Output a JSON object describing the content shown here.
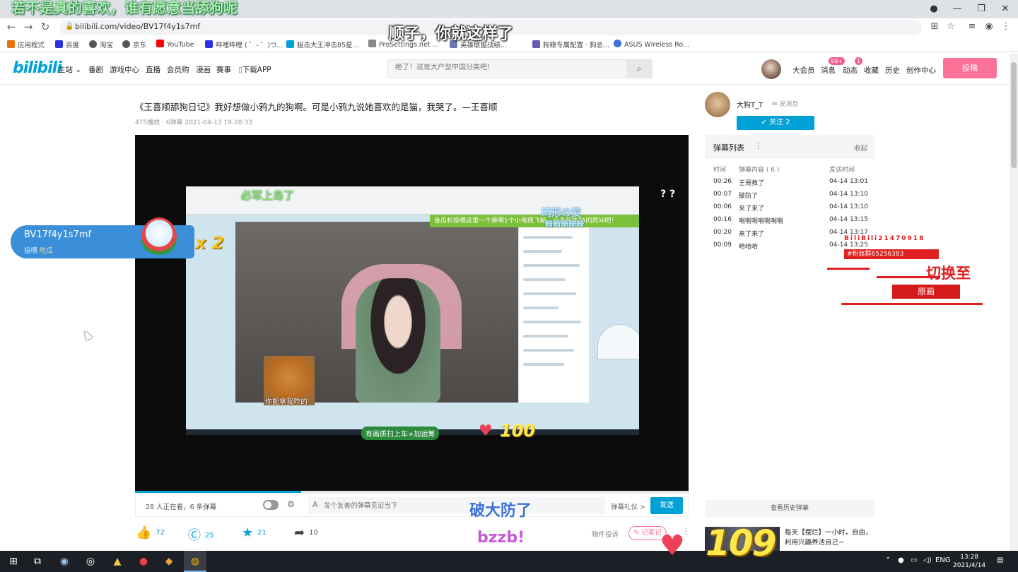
{
  "browser": {
    "url": "bilibili.com/video/BV17f4y1s7mf",
    "bookmarks": [
      "应用程式",
      "百度",
      "淘宝",
      "京东",
      "YouTube",
      "哔哩哔哩 ( ゜- ゜)つ...",
      "狙击大王冲击85星...",
      "ProSettings.net ...",
      "英雄联盟战绩...",
      "狗粮专属配置 · 狗总...",
      "ASUS Wireless Ro..."
    ],
    "window_controls": [
      "—",
      "❐",
      "✕"
    ]
  },
  "header": {
    "logo": "bilibili",
    "nav": [
      "主站",
      "番剧",
      "游戏中心",
      "直播",
      "会员购",
      "漫画",
      "赛事",
      "下载APP"
    ],
    "search_placeholder": "绝了！这是大户型中国分类吧!",
    "right_nav": [
      "大会员",
      "消息",
      "动态",
      "收藏",
      "历史",
      "创作中心"
    ],
    "badges": {
      "message": "99+",
      "dynamic": "1"
    },
    "upload_label": "投稿"
  },
  "video": {
    "title": "《王喜顺舔狗日记》我好想做小鸦九的狗啊。可是小鸦九说她喜欢的是猫，我哭了。—王喜顺",
    "meta": "475播放 · 6弹幕    2021-04-13 19:28:33",
    "progress": 0.3
  },
  "player_content": {
    "inner_text_1": "必军上岛了",
    "inner_text_2": "畸形の爱",
    "inner_text_3": "畸畸畸畸畸",
    "banner": "金瓜机投喂这里一个赛啊1个小电视飞船，点击前往TA的房间吧！",
    "dog_caption": "你能拿我咋的",
    "bottom_text": "有画质扫上车+加运筹",
    "question_marks": "? ?"
  },
  "danmaku_bar": {
    "viewers": "28 人正在看，6 条弹幕",
    "settings_icon": "⚙",
    "input_placeholder": "发个友善的弹幕见证当下",
    "etiquette": "弹幕礼仪 >",
    "send": "发送"
  },
  "actions": {
    "like": "72",
    "coin": "25",
    "favorite": "21",
    "share": "10",
    "report": "稿件投诉",
    "note": "记笔记",
    "more": "⋮"
  },
  "uploader": {
    "name": "大狗T_T",
    "message": "发消息",
    "follow": "✓  关注 2"
  },
  "danmaku_list": {
    "title": "弹幕列表",
    "collapse": "收起",
    "columns": [
      "时间",
      "弹幕内容 ( 6 )",
      "发送时间"
    ],
    "rows": [
      {
        "time": "00:26",
        "content": "王哥救了",
        "sent": "04-14 13:01"
      },
      {
        "time": "00:07",
        "content": "破防了",
        "sent": "04-14 13:10"
      },
      {
        "time": "00:06",
        "content": "来了来了",
        "sent": "04-14 13:10"
      },
      {
        "time": "00:16",
        "content": "啊啊啊啊啊啊啊",
        "sent": "04-14 13:15"
      },
      {
        "time": "00:20",
        "content": "来了来了",
        "sent": "04-14 13:17"
      },
      {
        "time": "00:09",
        "content": "哈哈哈",
        "sent": "04-14 13:25"
      }
    ],
    "history": "查看历史弹幕"
  },
  "recommend": {
    "title": "每天【摆烂】一小时，自由，利用兴趣养活自己~"
  },
  "overlays": {
    "caption_top": "若不是真的喜欢，谁有愿意当舔狗呢",
    "caption_mid": "顺子，你就这样了",
    "gift_user": "BV17f4y1s7mf",
    "gift_action": "投喂",
    "gift_item": "吃瓜",
    "gift_multiplier": "x 2",
    "danmaku_pofang": "破大防了",
    "danmaku_bzzb": "bzzb!",
    "counter_small": "100",
    "counter_big": "109",
    "glitch_1": "BiliBili21470918",
    "glitch_2": "#粉丝群65256383",
    "glitch_3": "切换至",
    "glitch_4": "原画"
  },
  "taskbar": {
    "lang": "ENG",
    "time": "13:28",
    "date": "2021/4/14"
  },
  "colors": {
    "accent": "#00a1d6",
    "pink": "#fb7299"
  }
}
